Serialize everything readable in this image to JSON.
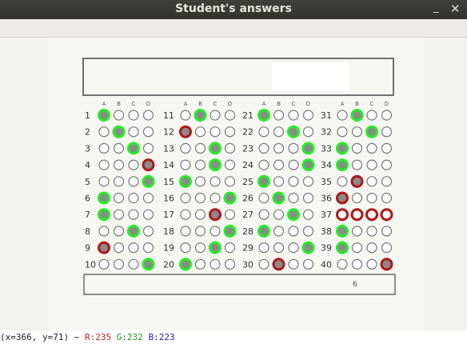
{
  "window": {
    "title": "Student's answers",
    "minimize_glyph": "_",
    "close_glyph": "✕"
  },
  "sheet": {
    "letters": [
      "A",
      "B",
      "C",
      "D"
    ],
    "footer_text": "6",
    "columns": [
      {
        "questions": [
          {
            "n": "1",
            "marks": [
              1,
              0,
              0,
              0
            ],
            "ring": "green",
            "ring_at": 0
          },
          {
            "n": "2",
            "marks": [
              0,
              1,
              0,
              0
            ],
            "ring": "green",
            "ring_at": 1
          },
          {
            "n": "3",
            "marks": [
              0,
              0,
              1,
              0
            ],
            "ring": "green",
            "ring_at": 2
          },
          {
            "n": "4",
            "marks": [
              0,
              0,
              0,
              1
            ],
            "ring": "red",
            "ring_at": 3
          },
          {
            "n": "5",
            "marks": [
              0,
              0,
              0,
              1
            ],
            "ring": "green",
            "ring_at": 3
          },
          {
            "n": "6",
            "marks": [
              1,
              0,
              0,
              0
            ],
            "ring": "green",
            "ring_at": 0
          },
          {
            "n": "7",
            "marks": [
              1,
              0,
              0,
              0
            ],
            "ring": "green",
            "ring_at": 0
          },
          {
            "n": "8",
            "marks": [
              0,
              0,
              1,
              0
            ],
            "ring": "green",
            "ring_at": 2
          },
          {
            "n": "9",
            "marks": [
              1,
              0,
              0,
              0
            ],
            "ring": "red",
            "ring_at": 0
          },
          {
            "n": "10",
            "marks": [
              0,
              0,
              0,
              1
            ],
            "ring": "green",
            "ring_at": 3
          }
        ]
      },
      {
        "questions": [
          {
            "n": "11",
            "marks": [
              0,
              1,
              0,
              0
            ],
            "ring": "green",
            "ring_at": 1
          },
          {
            "n": "12",
            "marks": [
              1,
              0,
              0,
              0
            ],
            "ring": "red",
            "ring_at": 0
          },
          {
            "n": "13",
            "marks": [
              0,
              0,
              1,
              0
            ],
            "ring": "green",
            "ring_at": 2
          },
          {
            "n": "14",
            "marks": [
              0,
              0,
              1,
              0
            ],
            "ring": "green",
            "ring_at": 2
          },
          {
            "n": "15",
            "marks": [
              1,
              0,
              0,
              0
            ],
            "ring": "green",
            "ring_at": 0
          },
          {
            "n": "16",
            "marks": [
              0,
              0,
              0,
              1
            ],
            "ring": "green",
            "ring_at": 3
          },
          {
            "n": "17",
            "marks": [
              0,
              0,
              1,
              0
            ],
            "ring": "red",
            "ring_at": 2
          },
          {
            "n": "18",
            "marks": [
              0,
              0,
              0,
              1
            ],
            "ring": "green",
            "ring_at": 3
          },
          {
            "n": "19",
            "marks": [
              0,
              0,
              1,
              0
            ],
            "ring": "green",
            "ring_at": 2
          },
          {
            "n": "20",
            "marks": [
              1,
              0,
              0,
              0
            ],
            "ring": "green",
            "ring_at": 0
          }
        ]
      },
      {
        "questions": [
          {
            "n": "21",
            "marks": [
              1,
              0,
              0,
              0
            ],
            "ring": "green",
            "ring_at": 0
          },
          {
            "n": "22",
            "marks": [
              0,
              0,
              1,
              0
            ],
            "ring": "green",
            "ring_at": 2
          },
          {
            "n": "23",
            "marks": [
              0,
              0,
              0,
              1
            ],
            "ring": "green",
            "ring_at": 3
          },
          {
            "n": "24",
            "marks": [
              0,
              0,
              0,
              1
            ],
            "ring": "green",
            "ring_at": 3
          },
          {
            "n": "25",
            "marks": [
              1,
              0,
              0,
              0
            ],
            "ring": "green",
            "ring_at": 0
          },
          {
            "n": "26",
            "marks": [
              0,
              1,
              0,
              0
            ],
            "ring": "green",
            "ring_at": 1
          },
          {
            "n": "27",
            "marks": [
              0,
              0,
              1,
              0
            ],
            "ring": "green",
            "ring_at": 2
          },
          {
            "n": "28",
            "marks": [
              1,
              0,
              0,
              0
            ],
            "ring": "green",
            "ring_at": 0
          },
          {
            "n": "29",
            "marks": [
              0,
              0,
              0,
              1
            ],
            "ring": "green",
            "ring_at": 3
          },
          {
            "n": "30",
            "marks": [
              0,
              1,
              0,
              0
            ],
            "ring": "red",
            "ring_at": 1
          }
        ]
      },
      {
        "questions": [
          {
            "n": "31",
            "marks": [
              0,
              1,
              0,
              0
            ],
            "ring": "green",
            "ring_at": 1
          },
          {
            "n": "32",
            "marks": [
              0,
              0,
              1,
              0
            ],
            "ring": "green",
            "ring_at": 2
          },
          {
            "n": "33",
            "marks": [
              1,
              0,
              0,
              0
            ],
            "ring": "green",
            "ring_at": 0
          },
          {
            "n": "34",
            "marks": [
              1,
              0,
              0,
              0
            ],
            "ring": "green",
            "ring_at": 0
          },
          {
            "n": "35",
            "marks": [
              0,
              1,
              0,
              0
            ],
            "ring": "red",
            "ring_at": 1
          },
          {
            "n": "36",
            "marks": [
              1,
              0,
              0,
              0
            ],
            "ring": "red",
            "ring_at": 0
          },
          {
            "n": "37",
            "marks": [
              0,
              0,
              0,
              0
            ],
            "ring": "red",
            "ring_at": -1
          },
          {
            "n": "38",
            "marks": [
              1,
              0,
              0,
              0
            ],
            "ring": "green",
            "ring_at": 0
          },
          {
            "n": "39",
            "marks": [
              1,
              0,
              0,
              0
            ],
            "ring": "green",
            "ring_at": 0
          },
          {
            "n": "40",
            "marks": [
              0,
              0,
              0,
              1
            ],
            "ring": "red",
            "ring_at": 3
          }
        ]
      }
    ]
  },
  "status": {
    "coords": "(x=366, y=71) ~",
    "r": "R:235",
    "g": "G:232",
    "b": "B:223"
  },
  "colors": {
    "green": "#22ee22",
    "red": "#b01818",
    "fill": "#8a8a8a",
    "bubble": "#777777",
    "titlebar": "#3c3b37"
  }
}
